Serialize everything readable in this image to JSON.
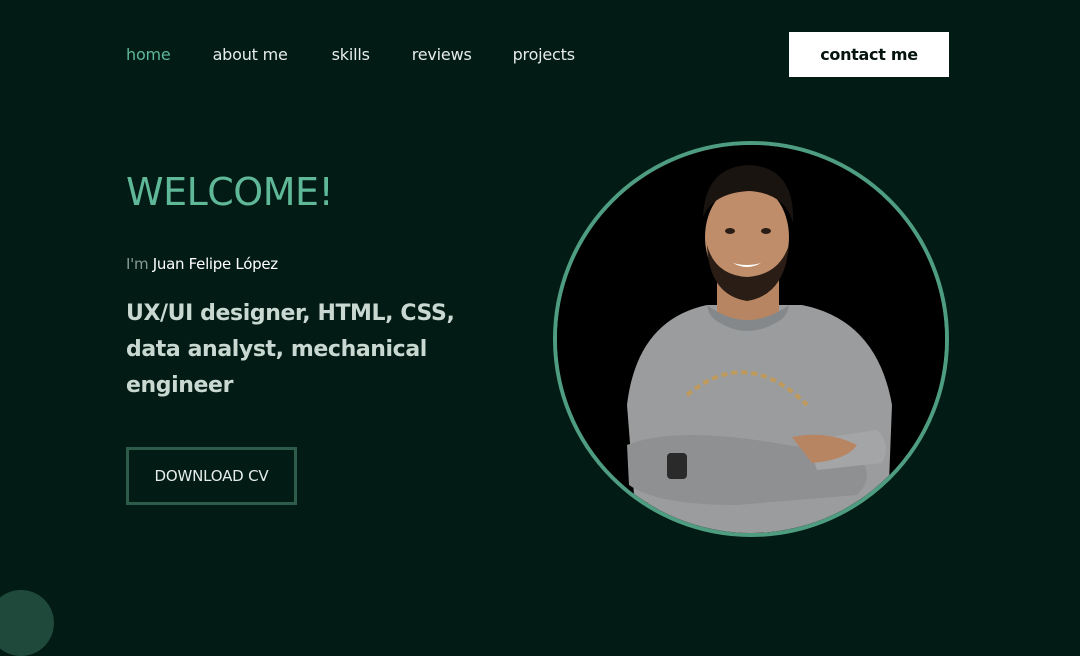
{
  "nav": {
    "items": [
      {
        "label": "home",
        "active": true
      },
      {
        "label": "about me"
      },
      {
        "label": "skills"
      },
      {
        "label": "reviews"
      },
      {
        "label": "projects"
      }
    ],
    "contact_label": "contact me"
  },
  "hero": {
    "welcome": "WELCOME!",
    "intro_prefix": "I'm",
    "name": "Juan Felipe López",
    "roles": "UX/UI designer, HTML, CSS, data analyst, mechanical engineer",
    "download_label": "DOWNLOAD CV"
  },
  "colors": {
    "background": "#021b14",
    "accent": "#5fb898",
    "ring": "#4e9d81",
    "button_bg": "#ffffff"
  }
}
